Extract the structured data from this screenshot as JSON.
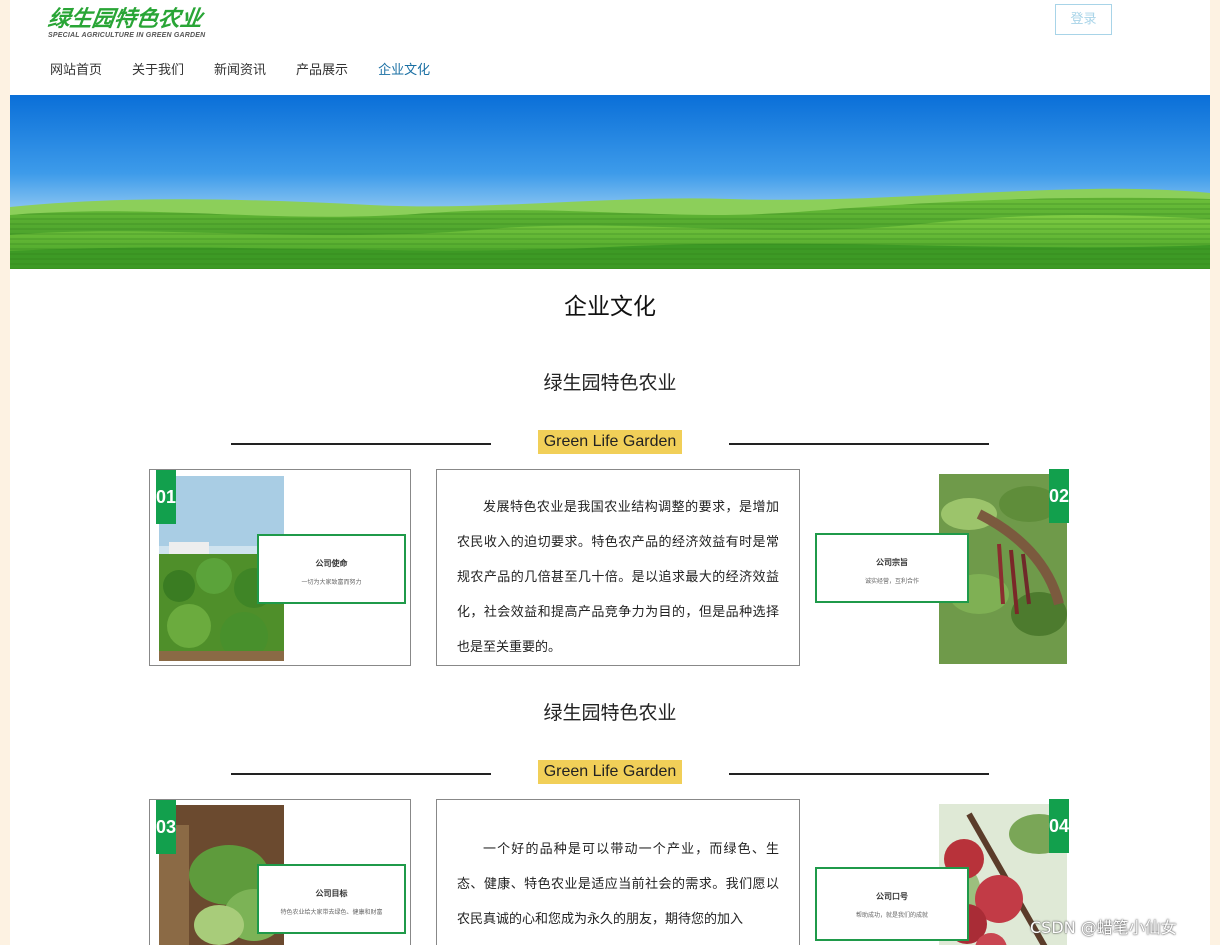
{
  "header": {
    "logo_main": "绿生园特色农业",
    "logo_sub": "SPECIAL AGRICULTURE IN GREEN GARDEN",
    "login_label": "登录"
  },
  "nav": {
    "items": [
      "网站首页",
      "关于我们",
      "新闻资讯",
      "产品展示",
      "企业文化"
    ],
    "active": "企业文化"
  },
  "page_title": "企业文化",
  "sections": [
    {
      "title": "绿生园特色农业",
      "tag": "Green Life Garden",
      "left_card": {
        "number": "01",
        "info_title": "公司使命",
        "info_sub": "一切为大家致富而努力"
      },
      "text": "发展特色农业是我国农业结构调整的要求，是增加农民收入的迫切要求。特色农产品的经济效益有时是常规农产品的几倍甚至几十倍。是以追求最大的经济效益化，社会效益和提高产品竞争力为目的，但是品种选择也是至关重要的。",
      "right_card": {
        "number": "02",
        "info_title": "公司宗旨",
        "info_sub": "诚实经营，互利合作"
      }
    },
    {
      "title": "绿生园特色农业",
      "tag": "Green Life Garden",
      "left_card": {
        "number": "03",
        "info_title": "公司目标",
        "info_sub": "特色农业给大家带去绿色、健康和财富"
      },
      "text": "一个好的品种是可以带动一个产业，而绿色、生态、健康、特色农业是适应当前社会的需求。我们愿以农民真诚的心和您成为永久的朋友，期待您的加入",
      "right_card": {
        "number": "04",
        "info_title": "公司口号",
        "info_sub": "帮助成功，就是我们的成就"
      }
    }
  ],
  "watermark": "CSDN @蜡笔小仙女",
  "colors": {
    "accent_green": "#12a04d",
    "tag_yellow": "#f1cf58",
    "nav_active": "#1a6fa3",
    "page_bg": "#fdf2e2"
  }
}
